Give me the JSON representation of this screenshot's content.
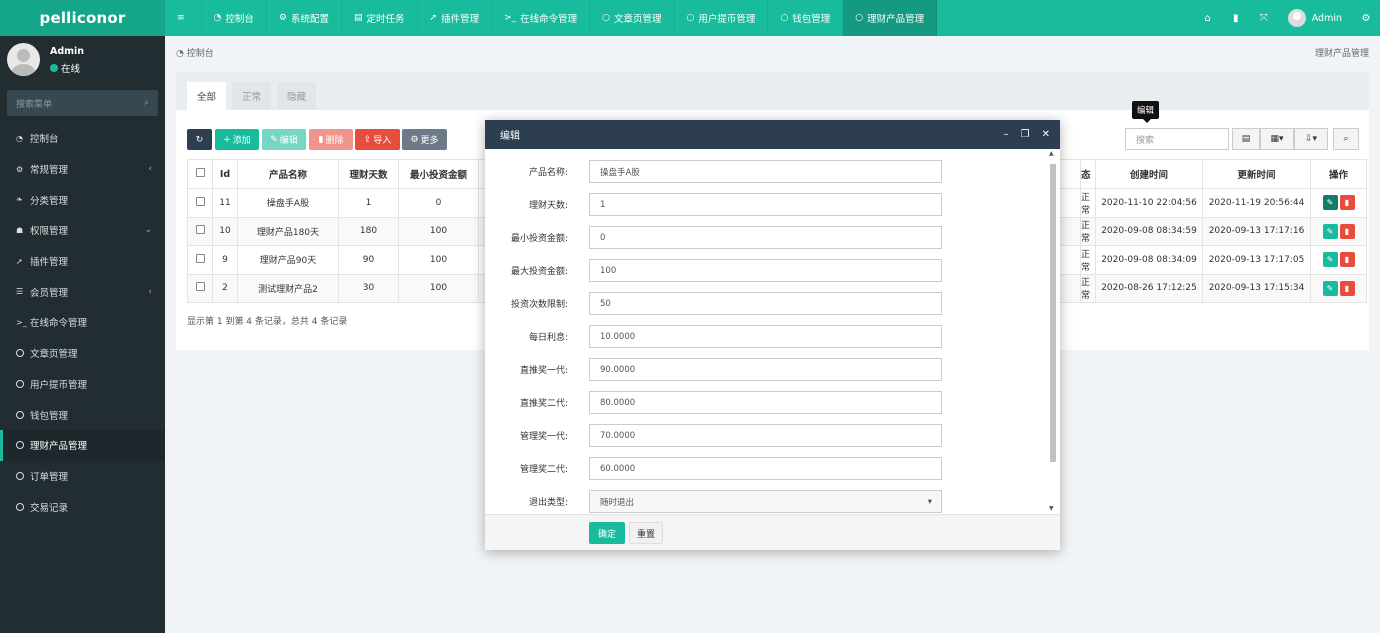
{
  "brand": "pelliconor",
  "topnav": [
    {
      "label": "",
      "icon": "menu-icon",
      "glyph": "≡"
    },
    {
      "label": "控制台",
      "icon": "dashboard-icon",
      "glyph": "◔"
    },
    {
      "label": "系统配置",
      "icon": "gears-icon",
      "glyph": "⚙"
    },
    {
      "label": "定时任务",
      "icon": "list-icon",
      "glyph": "▤"
    },
    {
      "label": "插件管理",
      "icon": "rocket-icon",
      "glyph": "➚"
    },
    {
      "label": "在线命令管理",
      "icon": "terminal-icon",
      "glyph": ">_"
    },
    {
      "label": "文章页管理",
      "icon": "circle-icon",
      "glyph": "○"
    },
    {
      "label": "用户提币管理",
      "icon": "circle-icon",
      "glyph": "○"
    },
    {
      "label": "钱包管理",
      "icon": "circle-icon",
      "glyph": "○"
    },
    {
      "label": "理财产品管理",
      "icon": "circle-icon",
      "glyph": "○"
    }
  ],
  "topright": {
    "username": "Admin"
  },
  "sidebar": {
    "user": {
      "name": "Admin",
      "status": "在线"
    },
    "search_placeholder": "搜索菜单",
    "items": [
      {
        "label": "控制台",
        "glyph": "◔",
        "arrow": ""
      },
      {
        "label": "常规管理",
        "glyph": "⚙",
        "arrow": "‹"
      },
      {
        "label": "分类管理",
        "glyph": "❧",
        "arrow": ""
      },
      {
        "label": "权限管理",
        "glyph": "☗",
        "arrow": "⌄"
      },
      {
        "label": "插件管理",
        "glyph": "➚",
        "arrow": ""
      },
      {
        "label": "会员管理",
        "glyph": "☰",
        "arrow": "‹"
      },
      {
        "label": "在线命令管理",
        "glyph": ">_",
        "arrow": ""
      },
      {
        "label": "文章页管理",
        "glyph": "",
        "arrow": ""
      },
      {
        "label": "用户提币管理",
        "glyph": "",
        "arrow": ""
      },
      {
        "label": "钱包管理",
        "glyph": "",
        "arrow": ""
      },
      {
        "label": "理财产品管理",
        "glyph": "",
        "arrow": "",
        "active": true
      },
      {
        "label": "订单管理",
        "glyph": "",
        "arrow": ""
      },
      {
        "label": "交易记录",
        "glyph": "",
        "arrow": ""
      }
    ]
  },
  "breadcrumb": {
    "home": "控制台",
    "current": "理财产品管理"
  },
  "tabs": [
    "全部",
    "正常",
    "隐藏"
  ],
  "toolbar": {
    "refresh": "↻",
    "add": "添加",
    "edit": "编辑",
    "delete": "删除",
    "import": "导入",
    "more": "更多"
  },
  "table_search_placeholder": "搜索",
  "table": {
    "headers": [
      "Id",
      "产品名称",
      "理财天数",
      "最小投资金额",
      "态",
      "创建时间",
      "更新时间",
      "操作"
    ],
    "rows": [
      {
        "id": "11",
        "name": "操盘手A股",
        "days": "1",
        "min": "0",
        "status": "正常",
        "created": "2020-11-10 22:04:56",
        "updated": "2020-11-19 20:56:44"
      },
      {
        "id": "10",
        "name": "理财产品180天",
        "days": "180",
        "min": "100",
        "status": "正常",
        "created": "2020-09-08 08:34:59",
        "updated": "2020-09-13 17:17:16"
      },
      {
        "id": "9",
        "name": "理财产品90天",
        "days": "90",
        "min": "100",
        "status": "正常",
        "created": "2020-09-08 08:34:09",
        "updated": "2020-09-13 17:17:05"
      },
      {
        "id": "2",
        "name": "测试理财产品2",
        "days": "30",
        "min": "100",
        "status": "正常",
        "created": "2020-08-26 17:12:25",
        "updated": "2020-09-13 17:15:34"
      }
    ]
  },
  "pager_text": "显示第 1 到第 4 条记录，总共 4 条记录",
  "tooltip": "编辑",
  "modal": {
    "title": "编辑",
    "fields": [
      {
        "label": "产品名称:",
        "value": "操盘手A股"
      },
      {
        "label": "理财天数:",
        "value": "1"
      },
      {
        "label": "最小投资金额:",
        "value": "0"
      },
      {
        "label": "最大投资金额:",
        "value": "100"
      },
      {
        "label": "投资次数限制:",
        "value": "50"
      },
      {
        "label": "每日利息:",
        "value": "10.0000"
      },
      {
        "label": "直推奖一代:",
        "value": "90.0000"
      },
      {
        "label": "直推奖二代:",
        "value": "80.0000"
      },
      {
        "label": "管理奖一代:",
        "value": "70.0000"
      },
      {
        "label": "管理奖二代:",
        "value": "60.0000"
      }
    ],
    "exit_type": {
      "label": "退出类型:",
      "value": "随时退出"
    },
    "ok": "确定",
    "reset": "重置"
  },
  "colors": {
    "accent": "#18bc9c",
    "sidebar": "#222d32",
    "modal_header": "#2c3e50",
    "danger": "#e74c3c",
    "warning": "#f39c12"
  }
}
